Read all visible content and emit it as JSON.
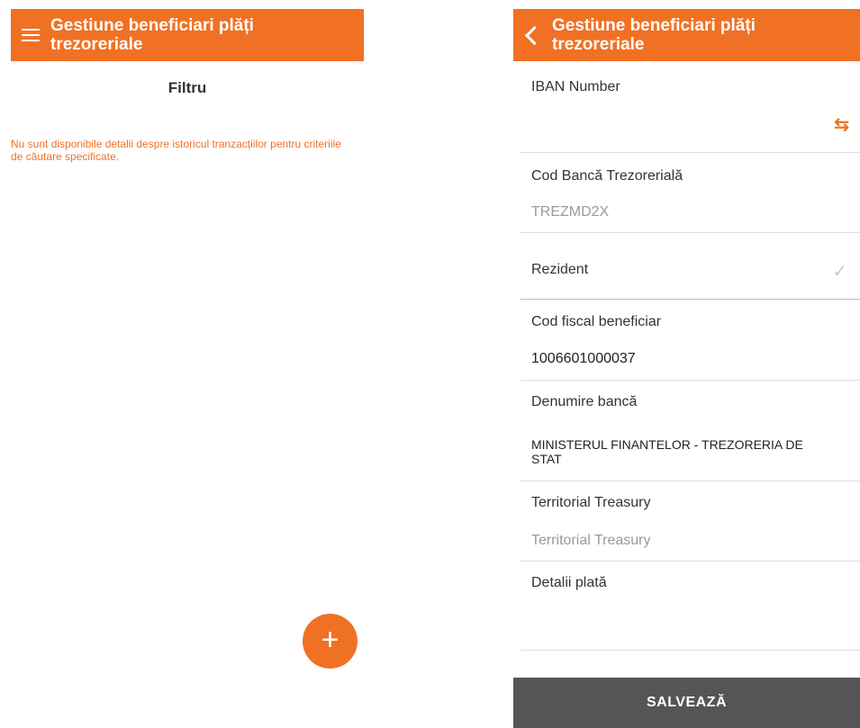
{
  "left": {
    "header": {
      "title_line1": "Gestiune beneficiari plăți",
      "title_line2": "trezoreriale"
    },
    "filter_label": "Filtru",
    "empty_message": "Nu sunt disponibile detalii despre istoricul tranzacțiilor pentru criteriile de căutare specificate.",
    "fab_label": "+"
  },
  "right": {
    "header": {
      "title_line1": "Gestiune beneficiari plăți",
      "title_line2": "trezoreriale"
    },
    "fields": {
      "iban": {
        "label": "IBAN Number",
        "value": ""
      },
      "bank_code": {
        "label": "Cod Bancă Trezorerială",
        "placeholder": "TREZMD2X"
      },
      "resident": {
        "label": "Rezident",
        "checked": true
      },
      "fiscal_code": {
        "label": "Cod fiscal beneficiar",
        "value": "1006601000037"
      },
      "bank_name": {
        "label": "Denumire bancă",
        "value_line1": "MINISTERUL FINANTELOR - TREZORERIA DE",
        "value_line2": "STAT"
      },
      "treasury": {
        "label": "Territorial Treasury",
        "placeholder": "Territorial Treasury"
      },
      "payment_details": {
        "label": "Detalii plată",
        "value": ""
      }
    },
    "save_label": "SALVEAZĂ"
  },
  "colors": {
    "accent": "#f07124",
    "save_bg": "#555555"
  },
  "icons": {
    "menu": "hamburger-icon",
    "back": "chevron-left-icon",
    "swap": "swap-icon",
    "check": "check-icon"
  }
}
